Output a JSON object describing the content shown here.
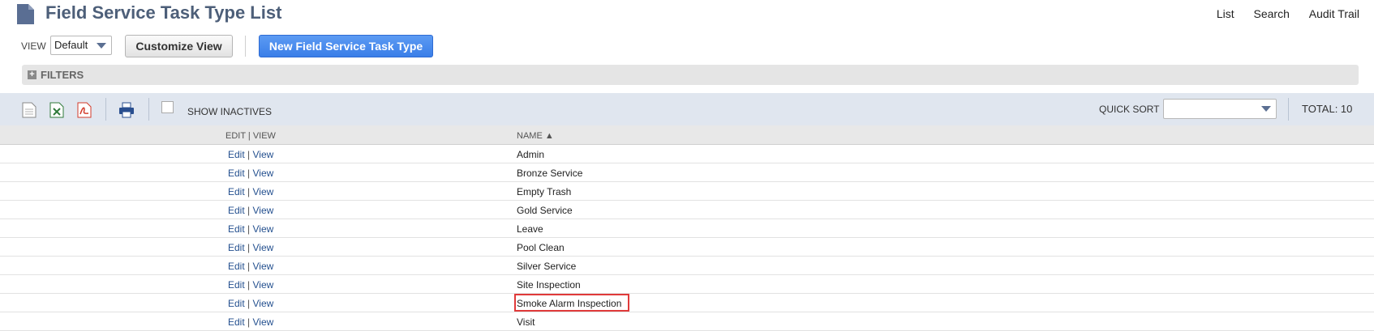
{
  "header": {
    "title": "Field Service Task Type List",
    "links": [
      "List",
      "Search",
      "Audit Trail"
    ]
  },
  "view": {
    "label": "VIEW",
    "selected": "Default",
    "customize_label": "Customize View",
    "new_label": "New Field Service Task Type"
  },
  "filters": {
    "label": "FILTERS"
  },
  "toolbar": {
    "show_inactives": "SHOW INACTIVES",
    "quick_sort_label": "QUICK SORT",
    "quick_sort_value": "",
    "total": "TOTAL: 10",
    "icons": [
      "export-csv-icon",
      "export-excel-icon",
      "export-pdf-icon",
      "print-icon"
    ]
  },
  "table": {
    "columns": {
      "edit": "EDIT | VIEW",
      "name": "NAME"
    },
    "edit_label": "Edit",
    "view_label": "View",
    "rows": [
      "Admin",
      "Bronze Service",
      "Empty Trash",
      "Gold Service",
      "Leave",
      "Pool Clean",
      "Silver Service",
      "Site Inspection",
      "Smoke Alarm Inspection",
      "Visit"
    ],
    "highlighted_row": "Smoke Alarm Inspection"
  },
  "colors": {
    "title": "#4d5f79",
    "primary_button": "#3a7ee8",
    "highlight_border": "#e03a3a",
    "link": "#24508f"
  }
}
